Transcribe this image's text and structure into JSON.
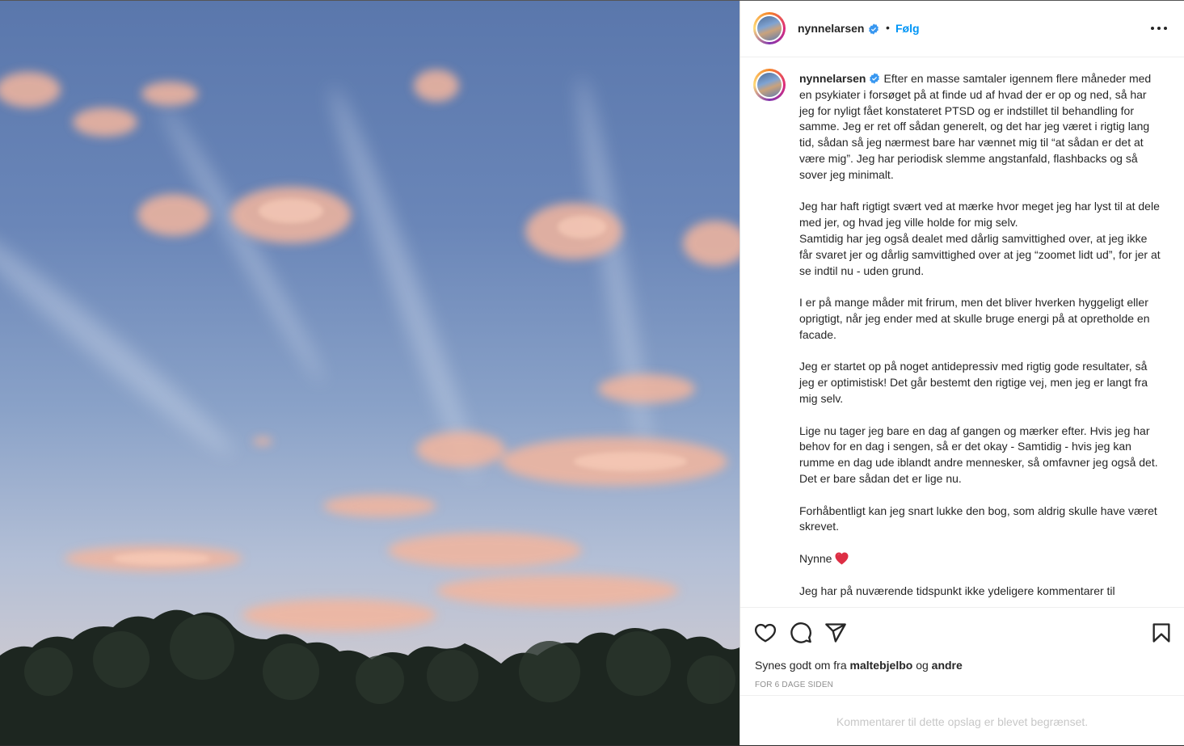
{
  "header": {
    "username": "nynnelarsen",
    "separator": "•",
    "follow_label": "Følg"
  },
  "caption": {
    "username": "nynnelarsen",
    "paragraphs": [
      "Efter en masse samtaler igennem flere måneder med en psykiater i forsøget på at finde ud af hvad der er op og ned, så har jeg for nyligt fået konstateret PTSD og er indstillet til behandling for samme. Jeg er ret off sådan generelt, og det har jeg været i rigtig lang tid, sådan så jeg nærmest bare har vænnet mig til “at sådan er det at være mig”. Jeg har periodisk slemme angstanfald, flashbacks og så sover jeg minimalt.",
      "Jeg har haft rigtigt svært ved at mærke hvor meget jeg har lyst til at dele med jer, og hvad jeg ville holde for mig selv.\nSamtidig har jeg også dealet med dårlig samvittighed over, at jeg ikke får svaret jer og dårlig samvittighed over at jeg “zoomet lidt ud”, for jer at se indtil nu - uden grund.",
      "I er på mange måder mit frirum, men det bliver hverken hyggeligt eller oprigtigt, når jeg ender med at skulle bruge energi på at opretholde en facade.",
      "Jeg er startet op på noget antidepressiv med rigtig gode resultater, så jeg er optimistisk! Det går bestemt den rigtige vej, men jeg er langt fra mig selv.",
      "Lige nu tager jeg bare en dag af gangen og mærker efter. Hvis jeg har behov for en dag i sengen, så er det okay - Samtidig - hvis jeg kan rumme en dag ude iblandt andre mennesker, så omfavner jeg også det. Det er bare sådan det er lige nu.",
      "Forhåbentligt kan jeg snart lukke den bog, som aldrig skulle have været skrevet."
    ],
    "signoff": "Nynne",
    "last_paragraph": "Jeg har på nuværende tidspunkt ikke ydeligere kommentarer til"
  },
  "likes": {
    "prefix": "Synes godt om fra",
    "user": "maltebjelbo",
    "conjunction": "og",
    "others": "andre"
  },
  "timestamp": "FOR 6 DAGE SIDEN",
  "comments_notice": "Kommentarer til dette opslag er blevet begrænset.",
  "icons": {
    "verified": "verified-badge-icon",
    "more": "more-options-icon",
    "like": "heart-icon",
    "comment": "comment-icon",
    "share": "share-icon",
    "save": "bookmark-icon",
    "signoff_emoji": "red-heart-icon"
  },
  "colors": {
    "accent": "#0095f6",
    "verified": "#3897f0",
    "muted": "#8e8e8e",
    "disabled": "#c7c7c7"
  }
}
